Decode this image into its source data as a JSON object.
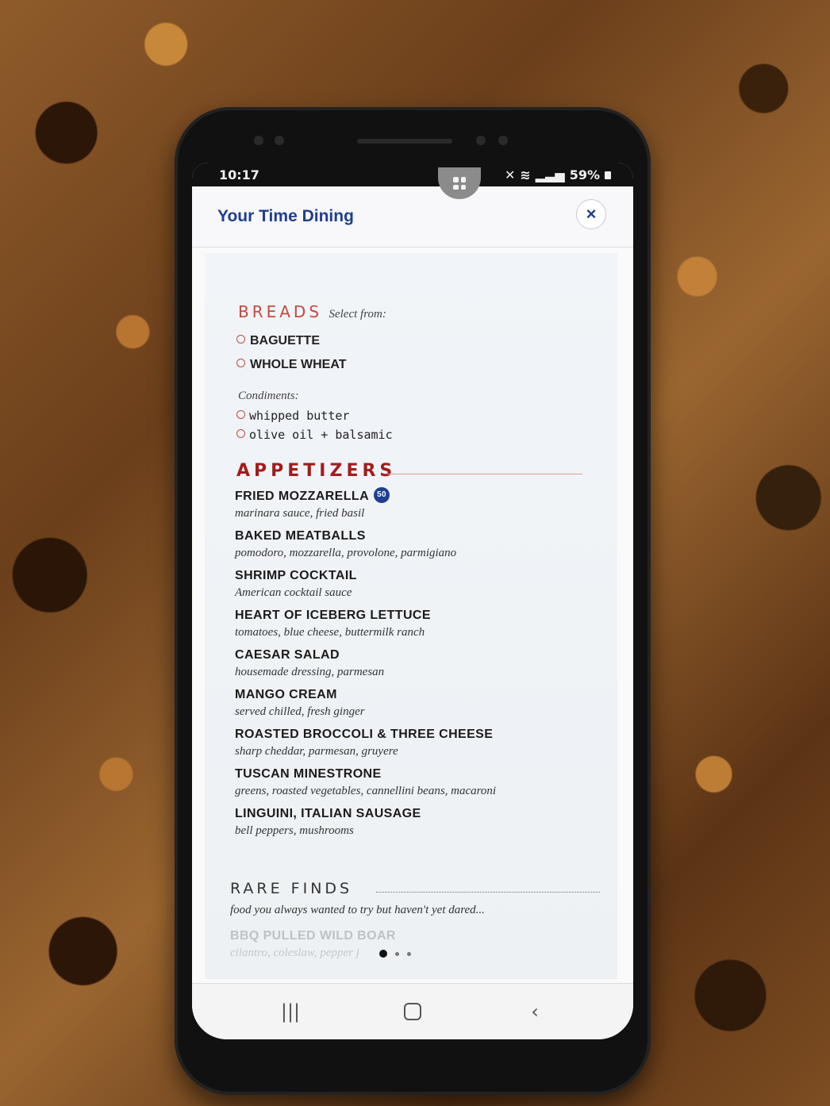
{
  "status_bar": {
    "time": "10:17",
    "battery": "59%"
  },
  "header": {
    "title": "Your Time Dining",
    "close_icon": "×"
  },
  "menu": {
    "breads": {
      "title": "BREADS",
      "subtitle": "Select from:",
      "options": [
        "BAGUETTE",
        "WHOLE WHEAT"
      ]
    },
    "condiments": {
      "title": "Condiments:",
      "options": [
        "whipped butter",
        "olive oil + balsamic"
      ]
    },
    "appetizers": {
      "title": "APPETIZERS",
      "items": [
        {
          "name": "FRIED MOZZARELLA",
          "description": "marinara sauce, fried basil",
          "badge": "50"
        },
        {
          "name": "BAKED MEATBALLS",
          "description": "pomodoro, mozzarella, provolone, parmigiano"
        },
        {
          "name": "SHRIMP COCKTAIL",
          "description": "American cocktail sauce"
        },
        {
          "name": "HEART OF ICEBERG LETTUCE",
          "description": "tomatoes, blue cheese, buttermilk ranch"
        },
        {
          "name": "CAESAR SALAD",
          "description": "housemade dressing, parmesan"
        },
        {
          "name": "MANGO CREAM",
          "description": "served chilled, fresh ginger"
        },
        {
          "name": "ROASTED BROCCOLI & THREE CHEESE",
          "description": "sharp cheddar, parmesan, gruyere"
        },
        {
          "name": "TUSCAN MINESTRONE",
          "description": "greens, roasted vegetables, cannellini beans, macaroni"
        },
        {
          "name": "LINGUINI, ITALIAN SAUSAGE",
          "description": "bell peppers, mushrooms"
        }
      ]
    },
    "rare_finds": {
      "title": "RARE FINDS",
      "description": "food you always wanted to try but haven't yet dared...",
      "partial_item": {
        "name": "BBQ PULLED WILD BOAR",
        "description": "cilantro, coleslaw, pepper j"
      }
    }
  },
  "pager": {
    "active_index": 0,
    "count": 3
  },
  "nav": {
    "recent_icon": "|||",
    "back_icon": "‹"
  },
  "colors": {
    "brand_blue": "#1f3f8f",
    "accent_red": "#a31c1c",
    "breads_red": "#c7483e"
  }
}
